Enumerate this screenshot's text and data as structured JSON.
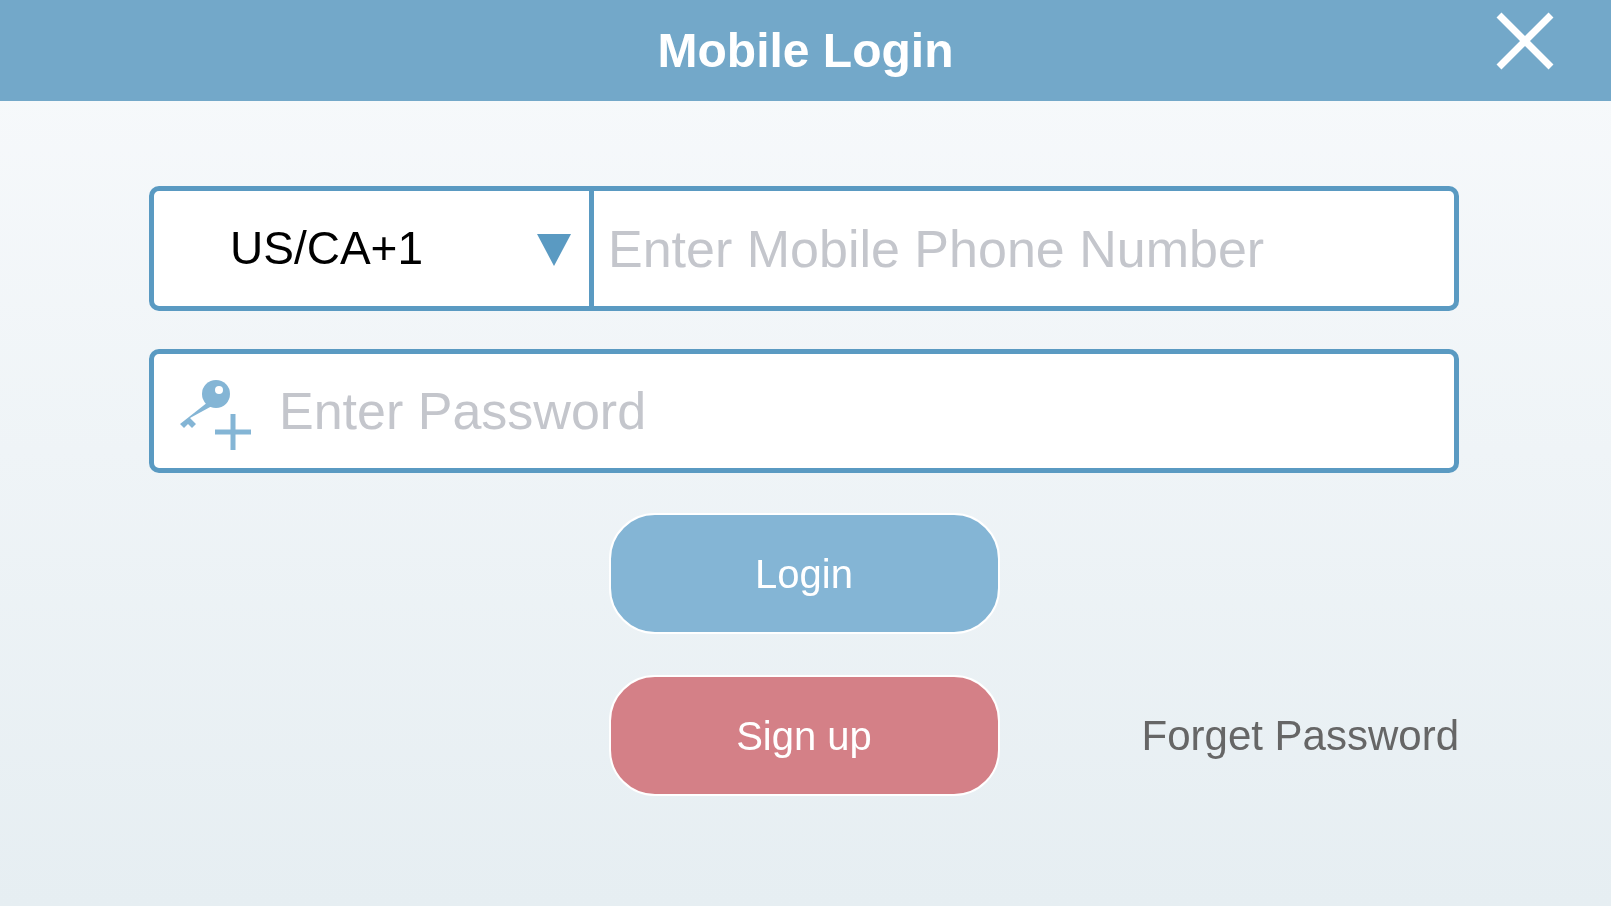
{
  "header": {
    "title": "Mobile Login"
  },
  "phone": {
    "country_code": "US/CA+1",
    "placeholder": "Enter Mobile Phone Number"
  },
  "password": {
    "placeholder": "Enter Password"
  },
  "buttons": {
    "login": "Login",
    "signup": "Sign up"
  },
  "forget_link": "Forget Password"
}
